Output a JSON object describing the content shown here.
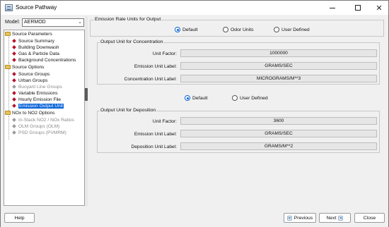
{
  "window": {
    "title": "Source Pathway"
  },
  "model": {
    "label": "Model:",
    "value": "AERMOD"
  },
  "tree": {
    "items": [
      {
        "label": "Source Parameters",
        "kind": "folder"
      },
      {
        "label": "Source Summary",
        "kind": "leaf"
      },
      {
        "label": "Building Downwash",
        "kind": "leaf"
      },
      {
        "label": "Gas & Particle Data",
        "kind": "leaf"
      },
      {
        "label": "Background Concentrations",
        "kind": "leaf"
      },
      {
        "label": "Source Options",
        "kind": "folder"
      },
      {
        "label": "Source Groups",
        "kind": "leaf"
      },
      {
        "label": "Urban Groups",
        "kind": "leaf"
      },
      {
        "label": "Buoyant Line Groups",
        "kind": "leaf-disabled"
      },
      {
        "label": "Variable Emissions",
        "kind": "leaf"
      },
      {
        "label": "Hourly Emission File",
        "kind": "leaf"
      },
      {
        "label": "Emission Output Unit",
        "kind": "leaf-selected"
      },
      {
        "label": "NOx to NO2 Options",
        "kind": "folder"
      },
      {
        "label": "In-Stack NO2 / NOx Ratios",
        "kind": "leaf-disabled"
      },
      {
        "label": "OLM Groups (OLM)",
        "kind": "leaf-disabled"
      },
      {
        "label": "PSD Groups (PVMRM)",
        "kind": "leaf-disabled"
      }
    ]
  },
  "emission_rate": {
    "title": "Emission Rate Units for Output",
    "options": [
      "Default",
      "Odor Units",
      "User Defined"
    ],
    "selected": "Default"
  },
  "concentration": {
    "title": "Output Unit for Concentration",
    "unit_factor_label": "Unit Factor:",
    "unit_factor_value": "1000000",
    "emission_unit_label": "Emission Unit Label:",
    "emission_unit_value": "GRAMS/SEC",
    "concentration_unit_label": "Concentration Unit Label:",
    "concentration_unit_value": "MICROGRAMS/M**3"
  },
  "deposition_options": {
    "options": [
      "Default",
      "User Defined"
    ],
    "selected": "Default"
  },
  "deposition": {
    "title": "Output Unit for Deposition",
    "unit_factor_label": "Unit Factor:",
    "unit_factor_value": "3600",
    "emission_unit_label": "Emission Unit Label:",
    "emission_unit_value": "GRAMS/SEC",
    "deposition_unit_label": "Deposition Unit Label:",
    "deposition_unit_value": "GRAMS/M**2"
  },
  "buttons": {
    "help": "Help",
    "previous": "Previous",
    "next": "Next",
    "close": "Close"
  }
}
